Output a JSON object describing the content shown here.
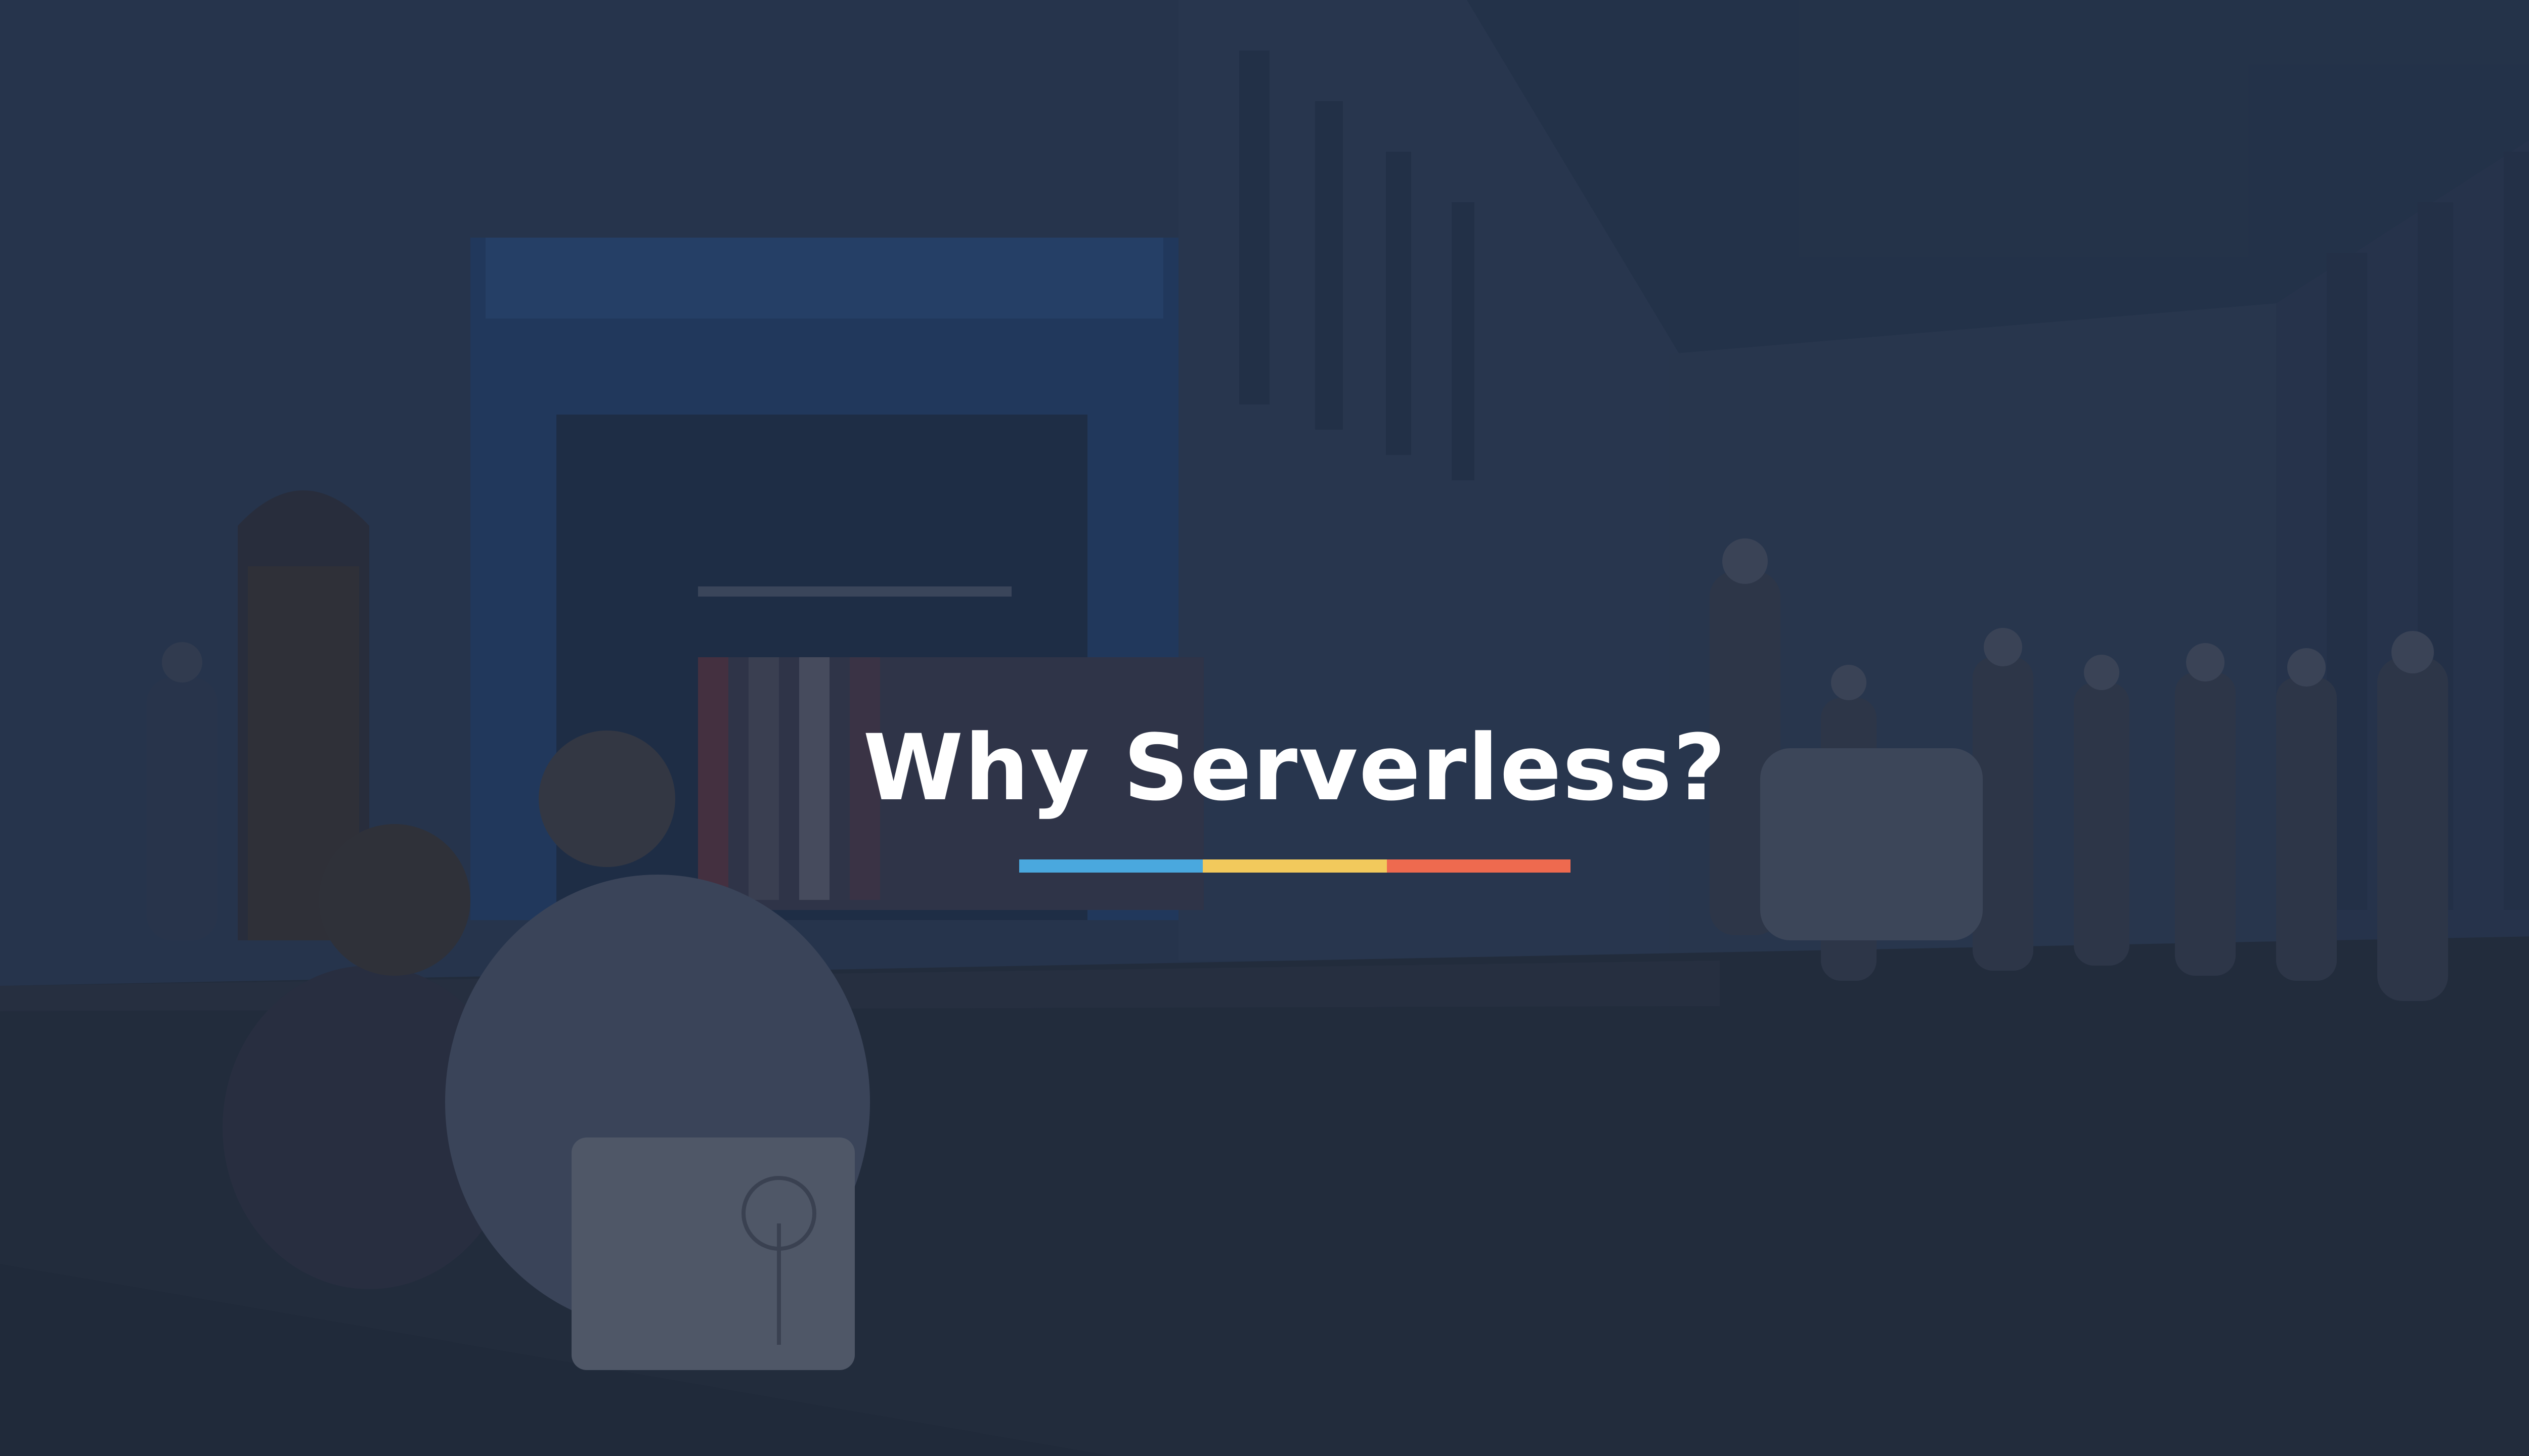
{
  "slide": {
    "title": "Why Serverless?",
    "underline_colors": [
      "#4aa8de",
      "#f2c95c",
      "#ee6a4f"
    ]
  }
}
